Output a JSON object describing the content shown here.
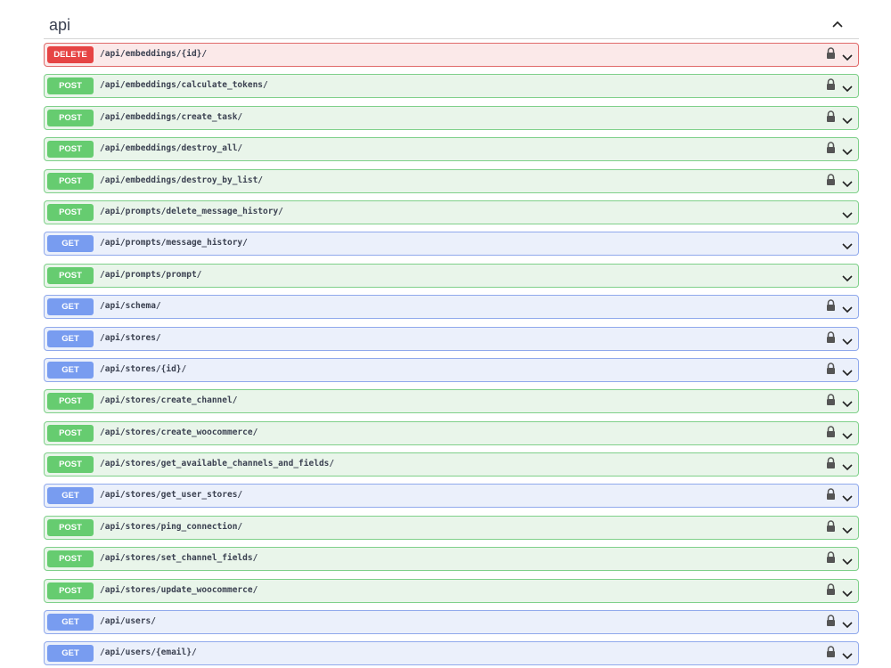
{
  "tag": {
    "title": "api"
  },
  "operations": [
    {
      "method": "DELETE",
      "path": "/api/embeddings/{id}/",
      "locked": true
    },
    {
      "method": "POST",
      "path": "/api/embeddings/calculate_tokens/",
      "locked": true
    },
    {
      "method": "POST",
      "path": "/api/embeddings/create_task/",
      "locked": true
    },
    {
      "method": "POST",
      "path": "/api/embeddings/destroy_all/",
      "locked": true
    },
    {
      "method": "POST",
      "path": "/api/embeddings/destroy_by_list/",
      "locked": true
    },
    {
      "method": "POST",
      "path": "/api/prompts/delete_message_history/",
      "locked": false
    },
    {
      "method": "GET",
      "path": "/api/prompts/message_history/",
      "locked": false
    },
    {
      "method": "POST",
      "path": "/api/prompts/prompt/",
      "locked": false
    },
    {
      "method": "GET",
      "path": "/api/schema/",
      "locked": true
    },
    {
      "method": "GET",
      "path": "/api/stores/",
      "locked": true
    },
    {
      "method": "GET",
      "path": "/api/stores/{id}/",
      "locked": true
    },
    {
      "method": "POST",
      "path": "/api/stores/create_channel/",
      "locked": true
    },
    {
      "method": "POST",
      "path": "/api/stores/create_woocommerce/",
      "locked": true
    },
    {
      "method": "POST",
      "path": "/api/stores/get_available_channels_and_fields/",
      "locked": true
    },
    {
      "method": "GET",
      "path": "/api/stores/get_user_stores/",
      "locked": true
    },
    {
      "method": "POST",
      "path": "/api/stores/ping_connection/",
      "locked": true
    },
    {
      "method": "POST",
      "path": "/api/stores/set_channel_fields/",
      "locked": true
    },
    {
      "method": "POST",
      "path": "/api/stores/update_woocommerce/",
      "locked": true
    },
    {
      "method": "GET",
      "path": "/api/users/",
      "locked": true
    },
    {
      "method": "GET",
      "path": "/api/users/{email}/",
      "locked": true
    }
  ]
}
